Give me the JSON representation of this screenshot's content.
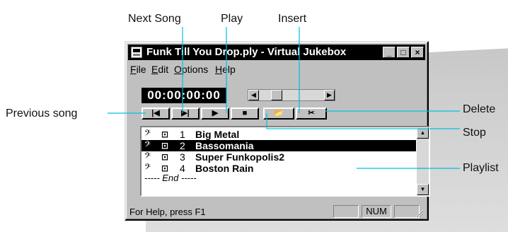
{
  "callouts": {
    "next_song": "Next Song",
    "play": "Play",
    "insert": "Insert",
    "previous_song": "Previous song",
    "delete": "Delete",
    "stop": "Stop",
    "playlist": "Playlist"
  },
  "window": {
    "title": "Funk Till You Drop.ply - Virtual Jukebox",
    "minimize_glyph": "_",
    "maximize_glyph": "□",
    "close_glyph": "×"
  },
  "menu": [
    {
      "label": "File",
      "mnemonic": "F",
      "rest": "ile"
    },
    {
      "label": "Edit",
      "mnemonic": "E",
      "rest": "dit"
    },
    {
      "label": "Options",
      "mnemonic": "O",
      "rest": "ptions"
    },
    {
      "label": "Help",
      "mnemonic": "H",
      "rest": "elp"
    }
  ],
  "time_display": "00:00:00:00",
  "toolbar": {
    "previous_icon": "previous-track-icon",
    "next_icon": "next-track-icon",
    "play_icon": "play-icon",
    "stop_icon": "stop-icon",
    "insert_icon": "folder-open-icon",
    "delete_icon": "scissors-icon",
    "previous_glyph": "|◀",
    "next_glyph": "▶|",
    "play_glyph": "▶",
    "stop_glyph": "■",
    "insert_glyph": "📂",
    "delete_glyph": "✂"
  },
  "playlist": {
    "items": [
      {
        "number": "1",
        "title": "Big Metal",
        "selected": false
      },
      {
        "number": "2",
        "title": "Bassomania",
        "selected": true
      },
      {
        "number": "3",
        "title": "Super Funkopolis2",
        "selected": false
      },
      {
        "number": "4",
        "title": "Boston Rain",
        "selected": false
      }
    ],
    "end_marker": "----- End -----",
    "clef_glyph": "𝄢",
    "tape_glyph": "⊡"
  },
  "status": {
    "help_text": "For Help, press F1",
    "num_indicator": "NUM"
  },
  "colors": {
    "window_bg": "#c0c0c0",
    "titlebar": "#000000",
    "selection": "#000000",
    "callout_line": "#00c0e0"
  }
}
